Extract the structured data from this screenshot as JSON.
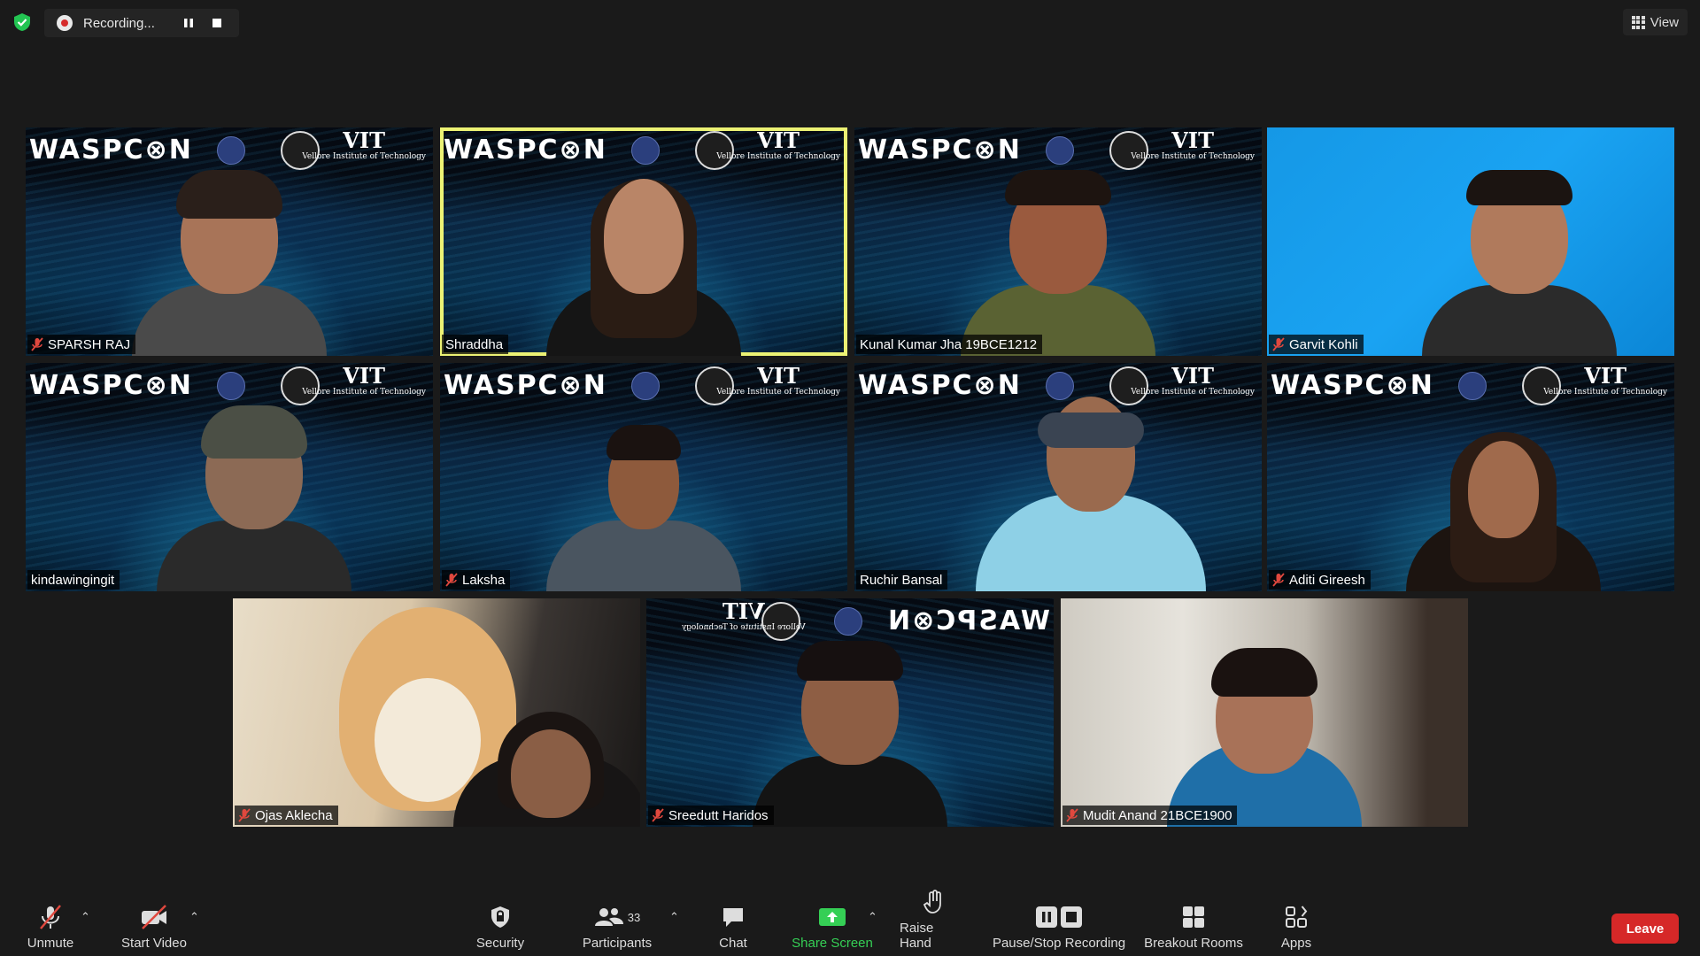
{
  "top": {
    "recording_label": "Recording...",
    "view_label": "View"
  },
  "participants": [
    {
      "name": "SPARSH RAJ",
      "muted": true
    },
    {
      "name": "Shraddha",
      "muted": false,
      "speaking": true
    },
    {
      "name": "Kunal Kumar Jha 19BCE1212",
      "muted": false
    },
    {
      "name": "Garvit Kohli",
      "muted": true
    },
    {
      "name": "kindawingingit",
      "muted": false
    },
    {
      "name": "Laksha",
      "muted": true
    },
    {
      "name": "Ruchir Bansal",
      "muted": false
    },
    {
      "name": "Aditi Gireesh",
      "muted": true
    },
    {
      "name": "Ojas Aklecha",
      "muted": true
    },
    {
      "name": "Sreedutt Haridos",
      "muted": true
    },
    {
      "name": "Mudit Anand 21BCE1900",
      "muted": true
    }
  ],
  "background": {
    "event_logo": "WASPC⊗N",
    "vit_title": "VIT",
    "vit_subtitle": "Vellore Institute of Technology"
  },
  "toolbar": {
    "unmute": "Unmute",
    "start_video": "Start Video",
    "security": "Security",
    "participants": "Participants",
    "participants_count": "33",
    "chat": "Chat",
    "share_screen": "Share Screen",
    "raise_hand": "Raise Hand",
    "pause_stop_recording": "Pause/Stop Recording",
    "breakout_rooms": "Breakout Rooms",
    "apps": "Apps",
    "leave": "Leave"
  },
  "colors": {
    "background": "#1a1a1a",
    "active_speaker_border": "#ecf274",
    "share_green": "#35cf55",
    "leave_red": "#d62828",
    "mute_red": "#e0483e"
  }
}
